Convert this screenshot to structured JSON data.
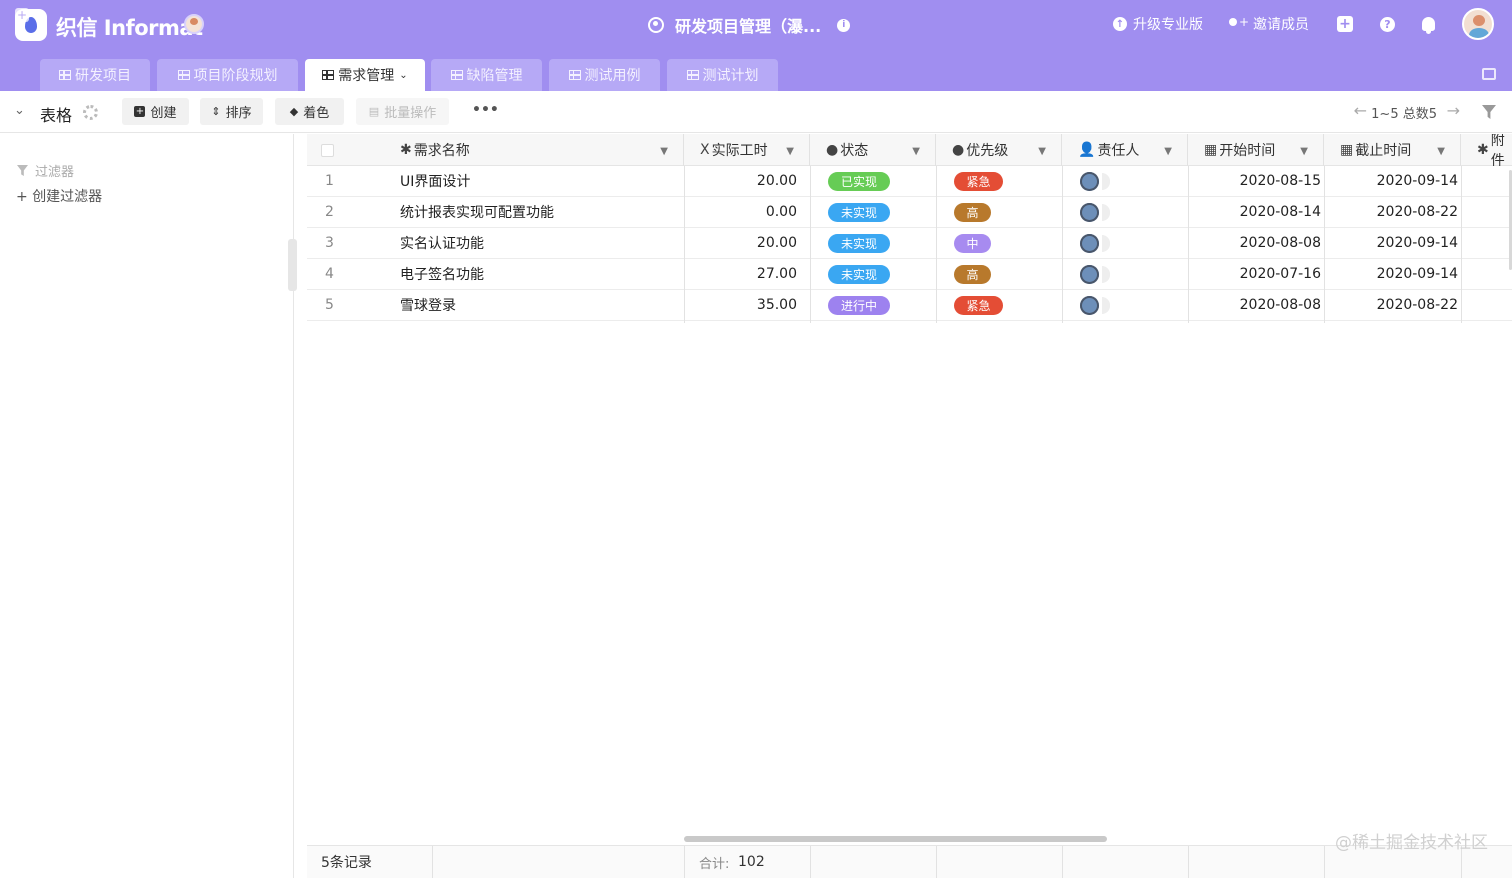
{
  "brand": {
    "name": "织信 Informat",
    "accent": "#a08ef0"
  },
  "header": {
    "app_title": "研发项目管理（瀑...",
    "upgrade_label": "升级专业版",
    "invite_label": "邀请成员"
  },
  "tabs": [
    {
      "label": "研发项目",
      "active": false
    },
    {
      "label": "项目阶段规划",
      "active": false
    },
    {
      "label": "需求管理",
      "active": true
    },
    {
      "label": "缺陷管理",
      "active": false
    },
    {
      "label": "测试用例",
      "active": false
    },
    {
      "label": "测试计划",
      "active": false
    }
  ],
  "toolbar": {
    "view_name": "表格",
    "create_label": "创建",
    "sort_label": "排序",
    "color_label": "着色",
    "batch_label": "批量操作",
    "pager_text": "1~5 总数5"
  },
  "sidebar": {
    "filter_label": "过滤器",
    "create_filter_label": "创建过滤器"
  },
  "table": {
    "columns": [
      {
        "label": "需求名称",
        "icon": "asterisk-icon"
      },
      {
        "label": "实际工时",
        "icon": "number-icon"
      },
      {
        "label": "状态",
        "icon": "check-circle-icon"
      },
      {
        "label": "优先级",
        "icon": "check-circle-icon"
      },
      {
        "label": "责任人",
        "icon": "person-icon"
      },
      {
        "label": "开始时间",
        "icon": "calendar-icon"
      },
      {
        "label": "截止时间",
        "icon": "calendar-icon"
      },
      {
        "label": "附件",
        "icon": "asterisk-icon"
      }
    ],
    "rows": [
      {
        "index": "1",
        "name": "UI界面设计",
        "hours": "20.00",
        "status": "已实现",
        "status_color": "#66cc55",
        "priority": "紧急",
        "priority_color": "#e44d35",
        "start": "2020-08-15",
        "end": "2020-09-14"
      },
      {
        "index": "2",
        "name": "统计报表实现可配置功能",
        "hours": "0.00",
        "status": "未实现",
        "status_color": "#3aa7f2",
        "priority": "高",
        "priority_color": "#b8792c",
        "start": "2020-08-14",
        "end": "2020-08-22"
      },
      {
        "index": "3",
        "name": "实名认证功能",
        "hours": "20.00",
        "status": "未实现",
        "status_color": "#3aa7f2",
        "priority": "中",
        "priority_color": "#a78bf0",
        "start": "2020-08-08",
        "end": "2020-09-14"
      },
      {
        "index": "4",
        "name": "电子签名功能",
        "hours": "27.00",
        "status": "未实现",
        "status_color": "#3aa7f2",
        "priority": "高",
        "priority_color": "#b8792c",
        "start": "2020-07-16",
        "end": "2020-09-14"
      },
      {
        "index": "5",
        "name": "雪球登录",
        "hours": "35.00",
        "status": "进行中",
        "status_color": "#9d82ef",
        "priority": "紧急",
        "priority_color": "#e44d35",
        "start": "2020-08-08",
        "end": "2020-08-22"
      }
    ],
    "footer": {
      "record_count": "5条记录",
      "sum_label": "合计:",
      "sum_value": "102"
    }
  },
  "watermark": "@稀土掘金技术社区"
}
